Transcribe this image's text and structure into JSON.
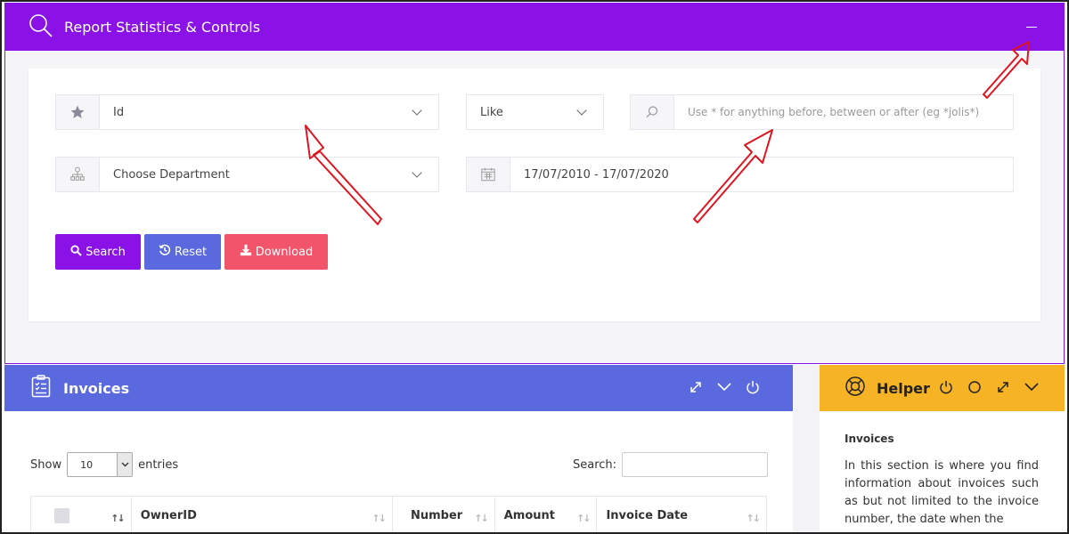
{
  "report": {
    "title": "Report Statistics & Controls"
  },
  "filters": {
    "field_select": "Id",
    "operator_select": "Like",
    "search_placeholder": "Use * for anything before, between or after (eg *jolis*)",
    "department_select": "Choose Department",
    "date_range": "17/07/2010 - 17/07/2020"
  },
  "buttons": {
    "search": "Search",
    "reset": "Reset",
    "download": "Download"
  },
  "invoices": {
    "title": "Invoices",
    "show_label": "Show",
    "entries_value": "10",
    "entries_label": "entries",
    "search_label": "Search:",
    "columns": [
      "OwnerID",
      "Number",
      "Amount",
      "Invoice Date"
    ]
  },
  "helper": {
    "title": "Helper",
    "heading": "Invoices",
    "text": "In this section is where you find information about invoices such as but not limited to the invoice number, the date when the"
  },
  "colors": {
    "report_header": "#8a12e6",
    "invoices_header": "#5a69de",
    "helper_header": "#f5b325",
    "search_button": "#8a12e6",
    "reset_button": "#5a69de",
    "download_button": "#f2546b",
    "annotation_arrow": "#e0141e"
  }
}
